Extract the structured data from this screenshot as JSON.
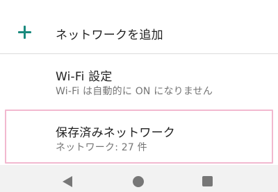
{
  "add_network": {
    "label": "ネットワークを追加",
    "icon": "plus-icon",
    "accent_color": "#1a8a7e"
  },
  "wifi_settings": {
    "title": "Wi-Fi 設定",
    "subtitle": "Wi-Fi は自動的に ON になりません"
  },
  "saved_networks": {
    "title": "保存済みネットワーク",
    "subtitle": "ネットワーク: 27 件"
  },
  "nav_bar": {
    "back_icon": "back-triangle-icon",
    "home_icon": "home-circle-icon",
    "recents_icon": "recents-square-icon"
  }
}
